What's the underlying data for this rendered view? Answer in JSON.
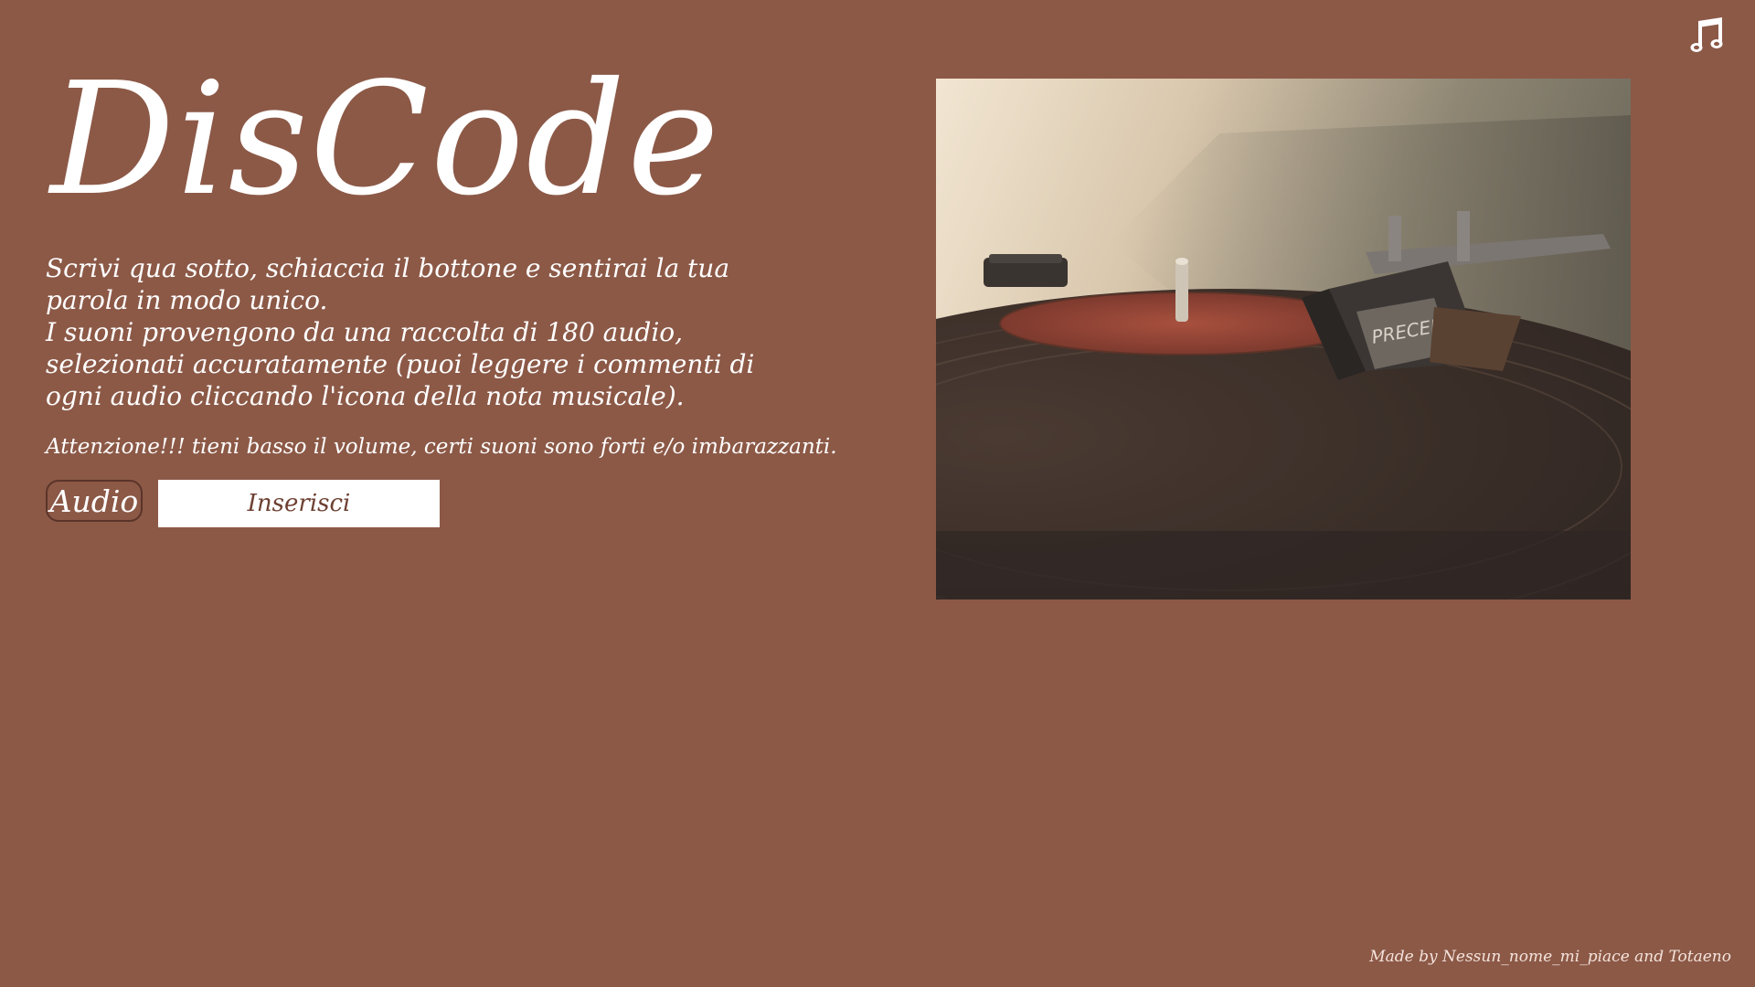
{
  "header": {
    "title": "DisCode",
    "music_icon": "music-note-icon"
  },
  "intro": {
    "line1": "Scrivi qua sotto, schiaccia il bottone e sentirai la tua parola in modo unico.",
    "line2": "I suoni provengono da una raccolta di 180 audio, selezionati accuratamente (puoi leggere i commenti di ogni audio cliccando l'icona della nota musicale)."
  },
  "warning": "Attenzione!!! tieni basso il volume, certi suoni sono forti e/o imbarazzanti.",
  "controls": {
    "audio_button_label": "Audio",
    "input_placeholder": "Inserisci",
    "input_value": ""
  },
  "image": {
    "subject": "turntable-photo",
    "cartridge_label": "PRECEPT"
  },
  "footer": {
    "credits": "Made by Nessun_nome_mi_piace and Totaeno"
  },
  "colors": {
    "background": "#8c5947",
    "text": "#ffffff",
    "input_background": "#ffffff",
    "button_border": "#5a3429"
  }
}
